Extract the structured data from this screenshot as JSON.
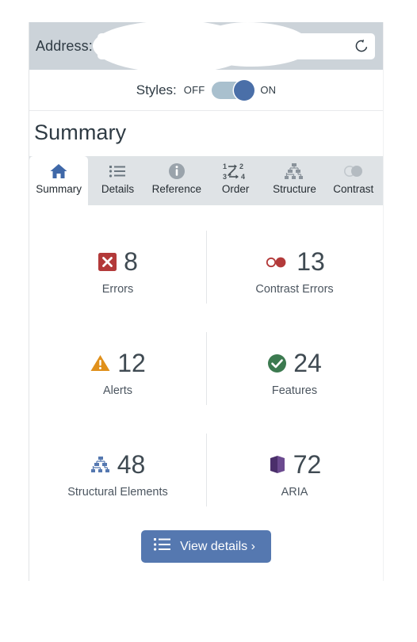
{
  "browser": {
    "address_label": "Address:",
    "address_value": "",
    "address_placeholder": "",
    "reload_icon": "reload-icon"
  },
  "styles_toggle": {
    "label": "Styles:",
    "off_label": "OFF",
    "on_label": "ON",
    "state": "ON"
  },
  "panel": {
    "title": "Summary"
  },
  "tabs": [
    {
      "label": "Summary",
      "icon": "home-icon",
      "active": true
    },
    {
      "label": "Details",
      "icon": "list-icon",
      "active": false
    },
    {
      "label": "Reference",
      "icon": "info-icon",
      "active": false
    },
    {
      "label": "Order",
      "icon": "order-icon",
      "active": false
    },
    {
      "label": "Structure",
      "icon": "structure-icon",
      "active": false
    },
    {
      "label": "Contrast",
      "icon": "contrast-icon",
      "active": false
    }
  ],
  "stats": [
    {
      "value": "8",
      "label": "Errors",
      "icon": "error-icon",
      "color": "#b33a3a"
    },
    {
      "value": "13",
      "label": "Contrast Errors",
      "icon": "contrast-error-icon",
      "color": "#b33a3a"
    },
    {
      "value": "12",
      "label": "Alerts",
      "icon": "alert-icon",
      "color": "#e0901b"
    },
    {
      "value": "24",
      "label": "Features",
      "icon": "feature-icon",
      "color": "#3c7a50"
    },
    {
      "value": "48",
      "label": "Structural Elements",
      "icon": "structure-stat-icon",
      "color": "#5578b0"
    },
    {
      "value": "72",
      "label": "ARIA",
      "icon": "aria-cube-icon",
      "color": "#5b3a7e"
    }
  ],
  "view_details": {
    "label": "View details ›",
    "icon": "list-icon"
  },
  "colors": {
    "accent": "#5578b0",
    "addressbar_bg": "#ccd3d9",
    "tabstrip_bg": "#dfe3e6",
    "error": "#b33a3a",
    "alert": "#e0901b",
    "feature": "#3c7a50",
    "aria": "#5b3a7e"
  }
}
